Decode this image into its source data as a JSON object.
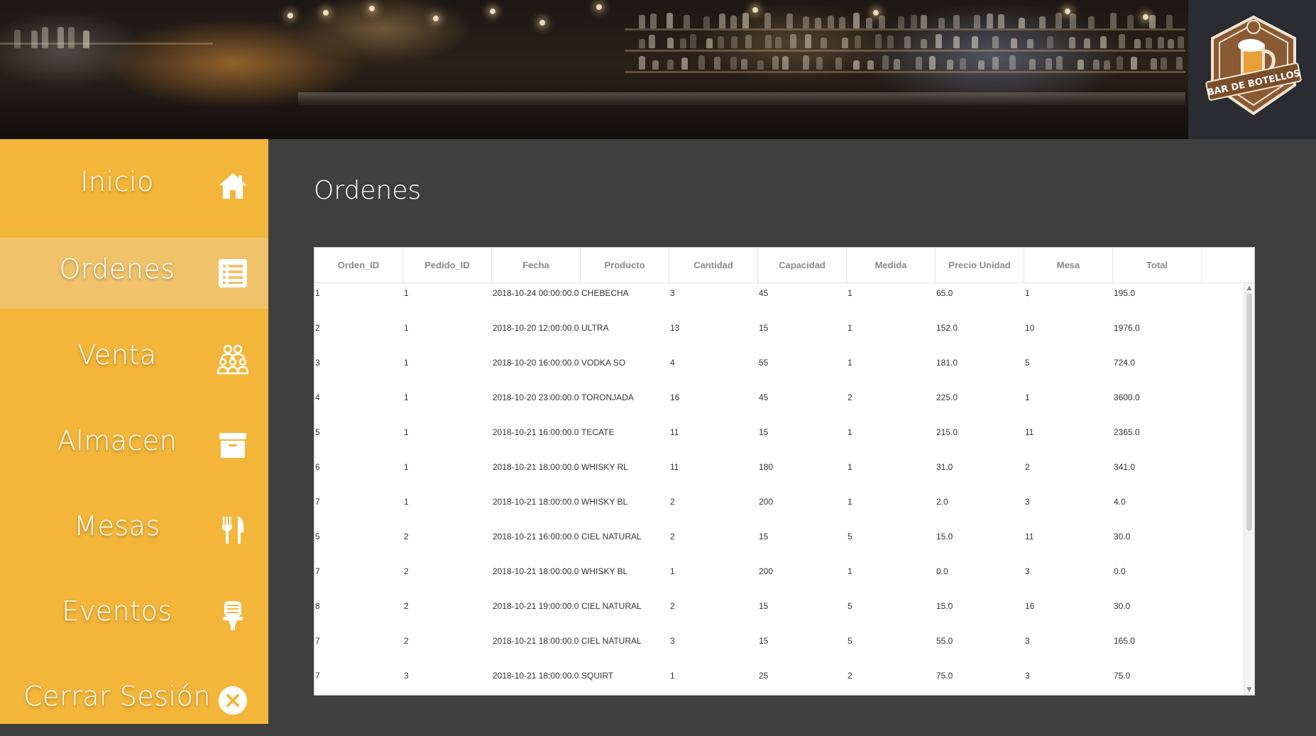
{
  "app": {
    "logo_text": "BAR DE BOTELLOS"
  },
  "sidebar": {
    "items": [
      {
        "label": "Inicio",
        "icon": "home-icon",
        "active": false
      },
      {
        "label": "Ordenes",
        "icon": "list-icon",
        "active": true
      },
      {
        "label": "Venta",
        "icon": "group-icon",
        "active": false
      },
      {
        "label": "Almacen",
        "icon": "archive-icon",
        "active": false
      },
      {
        "label": "Mesas",
        "icon": "utensils-icon",
        "active": false
      },
      {
        "label": "Eventos",
        "icon": "microphone-icon",
        "active": false
      },
      {
        "label": "Cerrar Sesión",
        "icon": "close-circle-icon",
        "active": false
      }
    ]
  },
  "main": {
    "title": "Ordenes"
  },
  "table": {
    "columns": [
      "Orden_ID",
      "Pedido_ID",
      "Fecha",
      "Producto",
      "Cantidad",
      "Capacidad",
      "Medida",
      "Precio Unidad",
      "Mesa",
      "Total"
    ],
    "rows": [
      [
        "1",
        "1",
        "2018-10-24 00:00:00.0",
        "CHEBECHA",
        "3",
        "45",
        "1",
        "65.0",
        "1",
        "195.0"
      ],
      [
        "2",
        "1",
        "2018-10-20 12:00:00.0",
        "ULTRA",
        "13",
        "15",
        "1",
        "152.0",
        "10",
        "1976.0"
      ],
      [
        "3",
        "1",
        "2018-10-20 16:00:00.0",
        "VODKA SO",
        "4",
        "55",
        "1",
        "181.0",
        "5",
        "724.0"
      ],
      [
        "4",
        "1",
        "2018-10-20 23:00:00.0",
        "TORONJADA",
        "16",
        "45",
        "2",
        "225.0",
        "1",
        "3600.0"
      ],
      [
        "5",
        "1",
        "2018-10-21 16:00:00.0",
        "TECATE",
        "11",
        "15",
        "1",
        "215.0",
        "11",
        "2365.0"
      ],
      [
        "6",
        "1",
        "2018-10-21 18:00:00.0",
        "WHISKY RL",
        "11",
        "180",
        "1",
        "31.0",
        "2",
        "341.0"
      ],
      [
        "7",
        "1",
        "2018-10-21 18:00:00.0",
        "WHISKY BL",
        "2",
        "200",
        "1",
        "2.0",
        "3",
        "4.0"
      ],
      [
        "5",
        "2",
        "2018-10-21 16:00:00.0",
        "CIEL NATURAL",
        "2",
        "15",
        "5",
        "15.0",
        "11",
        "30.0"
      ],
      [
        "7",
        "2",
        "2018-10-21 18:00:00.0",
        "WHISKY BL",
        "1",
        "200",
        "1",
        "0.0",
        "3",
        "0.0"
      ],
      [
        "8",
        "2",
        "2018-10-21 19:00:00.0",
        "CIEL NATURAL",
        "2",
        "15",
        "5",
        "15.0",
        "16",
        "30.0"
      ],
      [
        "7",
        "2",
        "2018-10-21 18:00:00.0",
        "CIEL NATURAL",
        "3",
        "15",
        "5",
        "55.0",
        "3",
        "165.0"
      ],
      [
        "7",
        "3",
        "2018-10-21 18:00:00.0",
        "SQUIRT",
        "1",
        "25",
        "2",
        "75.0",
        "3",
        "75.0"
      ]
    ]
  },
  "colors": {
    "sidebar_bg": "#f4b63a",
    "sidebar_active": "#f0c36b",
    "main_bg": "#3f3f3f"
  }
}
